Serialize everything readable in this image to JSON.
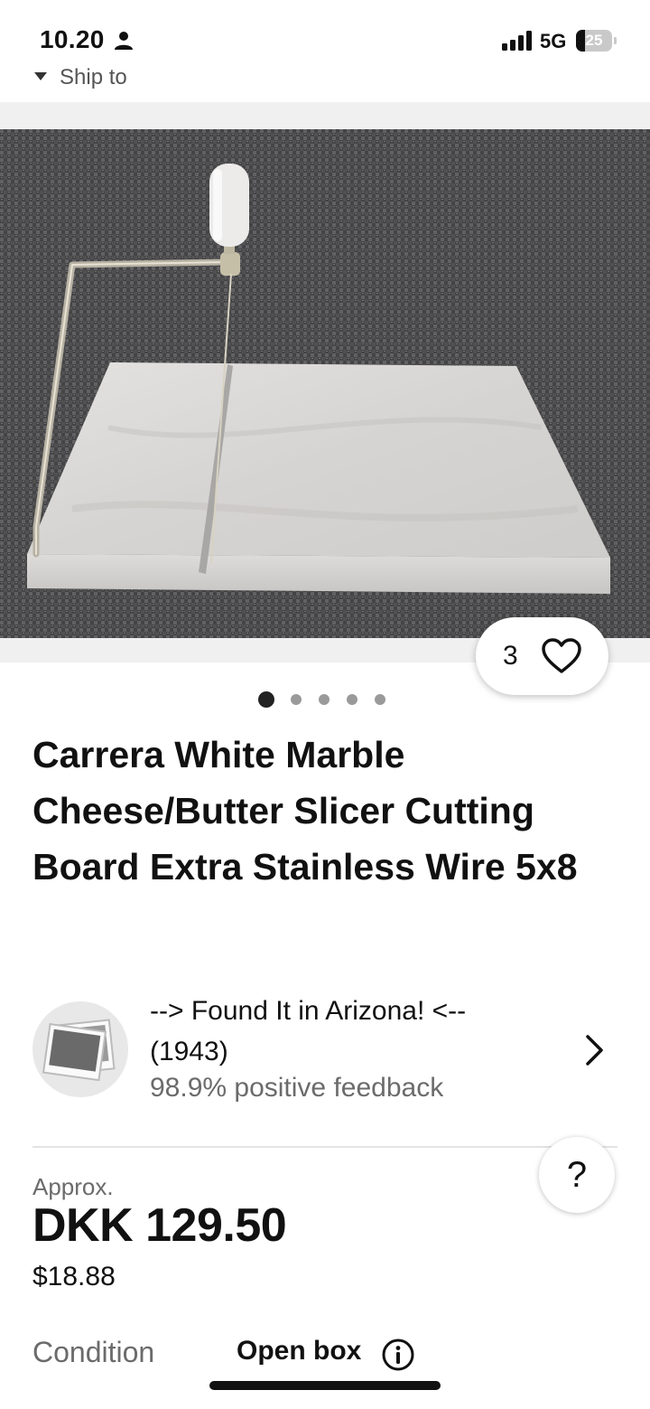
{
  "status_bar": {
    "time": "10.20",
    "network": "5G",
    "battery_level": "25",
    "battery_fraction": 0.25
  },
  "header": {
    "ship_to_label": "Ship to"
  },
  "gallery": {
    "image_count": 5,
    "active_index": 0,
    "watch_count": "3"
  },
  "listing": {
    "title": "Carrera White Marble Cheese/Butter Slicer Cutting Board Extra Stainless Wire 5x8"
  },
  "seller": {
    "name": "--> Found It in Arizona! <-- (1943)",
    "feedback": "98.9% positive feedback"
  },
  "price": {
    "approx_label": "Approx.",
    "local": "DKK 129.50",
    "usd": "$18.88"
  },
  "condition": {
    "label": "Condition",
    "value": "Open box"
  },
  "help": {
    "label": "?"
  }
}
